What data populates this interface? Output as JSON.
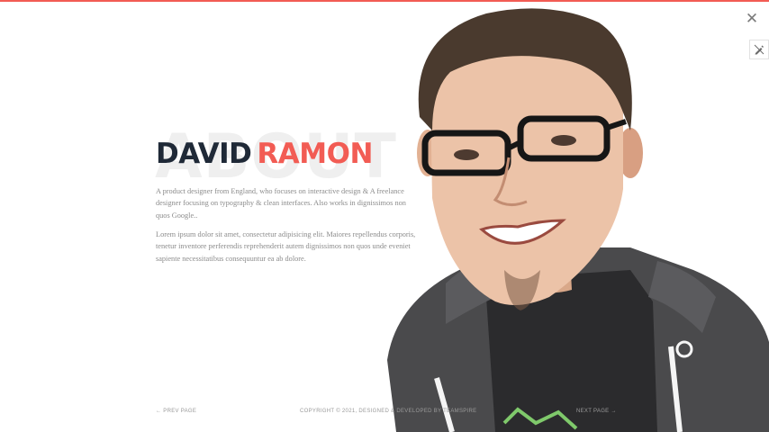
{
  "icons": {
    "close": "close-icon",
    "side_tool": "pen-icon"
  },
  "about": {
    "background_word": "ABOUT",
    "first_name": "DAVID",
    "last_name": "RAMON",
    "paragraph_1": "A product designer from England, who focuses on interactive design & A freelance designer focusing on typography & clean interfaces. Also works in dignissimos non quos Google..",
    "paragraph_2": "Lorem ipsum dolor sit amet, consectetur adipisicing elit. Maiores repellendus corporis, tenetur inventore perferendis reprehenderit autem dignissimos non quos unde eveniet sapiente necessitatibus consequuntur ea ab dolore."
  },
  "footer": {
    "prev_label": "← PREV PAGE",
    "copyright": "COPYRIGHT © 2021, DESIGNED & DEVELOPED BY TEAMSPIRE",
    "next_label": "NEXT PAGE →"
  },
  "colors": {
    "accent": "#f25c54",
    "name_dark": "#1f2937",
    "muted_text": "#8c8c8c"
  }
}
